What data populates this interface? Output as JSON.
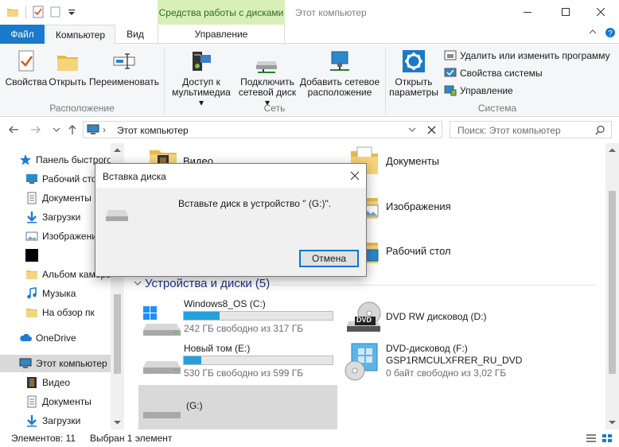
{
  "window": {
    "title": "Этот компьютер",
    "contextual_tab": "Средства работы с дисками"
  },
  "ribbon_tabs": {
    "file": "Файл",
    "computer": "Компьютер",
    "view": "Вид",
    "manage": "Управление"
  },
  "ribbon": {
    "location": {
      "properties": "Свойства",
      "open": "Открыть",
      "rename": "Переименовать",
      "label": "Расположение"
    },
    "network": {
      "media_l1": "Доступ к",
      "media_l2": "мультимедиа",
      "map_l1": "Подключить",
      "map_l2": "сетевой диск",
      "add_l1": "Добавить сетевое",
      "add_l2": "расположение",
      "label": "Сеть"
    },
    "system": {
      "open_l1": "Открыть",
      "open_l2": "параметры",
      "uninstall": "Удалить или изменить программу",
      "sysprops": "Свойства системы",
      "manage": "Управление",
      "label": "Система"
    }
  },
  "address": {
    "path": "Этот компьютер",
    "search_placeholder": "Поиск: Этот компьютер"
  },
  "nav": {
    "quick_access": "Панель быстрого доступа",
    "desktop": "Рабочий стол",
    "documents": "Документы",
    "downloads": "Загрузки",
    "images": "Изображения",
    "album": "Альбом камеры",
    "music": "Музыка",
    "review": "На обзор пк",
    "onedrive": "OneDrive",
    "this_pc": "Этот компьютер",
    "video": "Видео",
    "documents2": "Документы",
    "downloads2": "Загрузки"
  },
  "folders": {
    "video": "Видео",
    "documents": "Документы",
    "images": "Изображения",
    "desktop": "Рабочий стол"
  },
  "devices": {
    "header": "Устройства и диски (5)",
    "c": {
      "name": "Windows8_OS (C:)",
      "free": "242 ГБ свободно из 317 ГБ",
      "used_fraction": 0.24
    },
    "e": {
      "name": "Новый том (E:)",
      "free": "530 ГБ свободно из 599 ГБ",
      "used_fraction": 0.12
    },
    "d": {
      "name": "DVD RW дисковод (D:)",
      "badge": "DVD"
    },
    "f": {
      "name1": "DVD-дисковод (F:)",
      "name2": "GSP1RMCULXFRER_RU_DVD",
      "free": "0 байт свободно из 3,02 ГБ"
    },
    "g": {
      "name": "(G:)"
    }
  },
  "dialog": {
    "title": "Вставка диска",
    "message": "Вставьте диск в устройство \" (G:)\".",
    "cancel": "Отмена"
  },
  "status": {
    "items": "Элементов: 11",
    "selected": "Выбран 1 элемент"
  },
  "colors": {
    "accent": "#1979ca",
    "context_tab_bg": "#d8f0b8",
    "bar_fill": "#26a0da",
    "selection": "#d9d9d9"
  }
}
